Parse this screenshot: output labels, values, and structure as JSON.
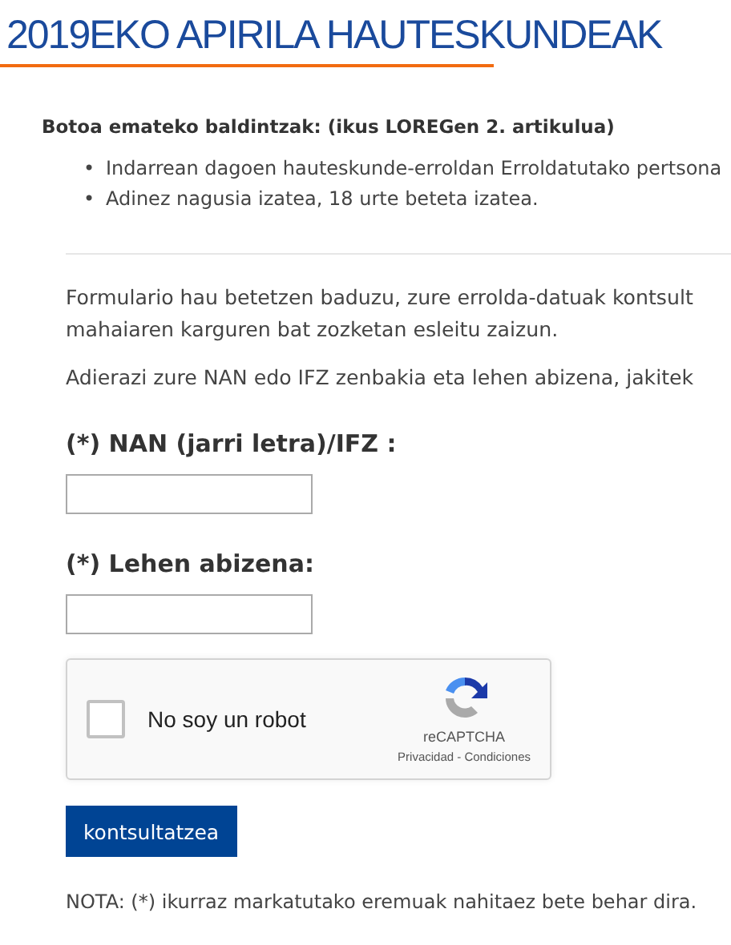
{
  "title": "2019EKO APIRILA HAUTESKUNDEAK",
  "requirements": {
    "heading": "Botoa emateko baldintzak: (ikus LOREGen 2. artikulua)",
    "items": [
      {
        "bullet": "•",
        "text": "Indarrean dagoen hauteskunde-erroldan Erroldatutako pertsona"
      },
      {
        "bullet": "•",
        "text": "Adinez nagusia izatea, 18 urte beteta izatea."
      }
    ]
  },
  "intro": [
    "Formulario hau betetzen baduzu, zure errolda-datuak kontsult",
    "mahaiaren karguren bat zozketan esleitu zaizun.",
    "Adierazi zure NAN edo IFZ zenbakia eta lehen abizena, jakitek"
  ],
  "fields": [
    {
      "label": "(*) NAN (jarri letra)/IFZ :"
    },
    {
      "label": "(*) Lehen abizena:"
    }
  ],
  "captcha": {
    "label": "No soy un robot",
    "checked": false,
    "brand": "reCAPTCHA",
    "links": "Privacidad - Condiciones"
  },
  "submit": "kontsultatzea",
  "note": "NOTA: (*) ikurraz markatutako eremuak nahitaez bete behar dira."
}
